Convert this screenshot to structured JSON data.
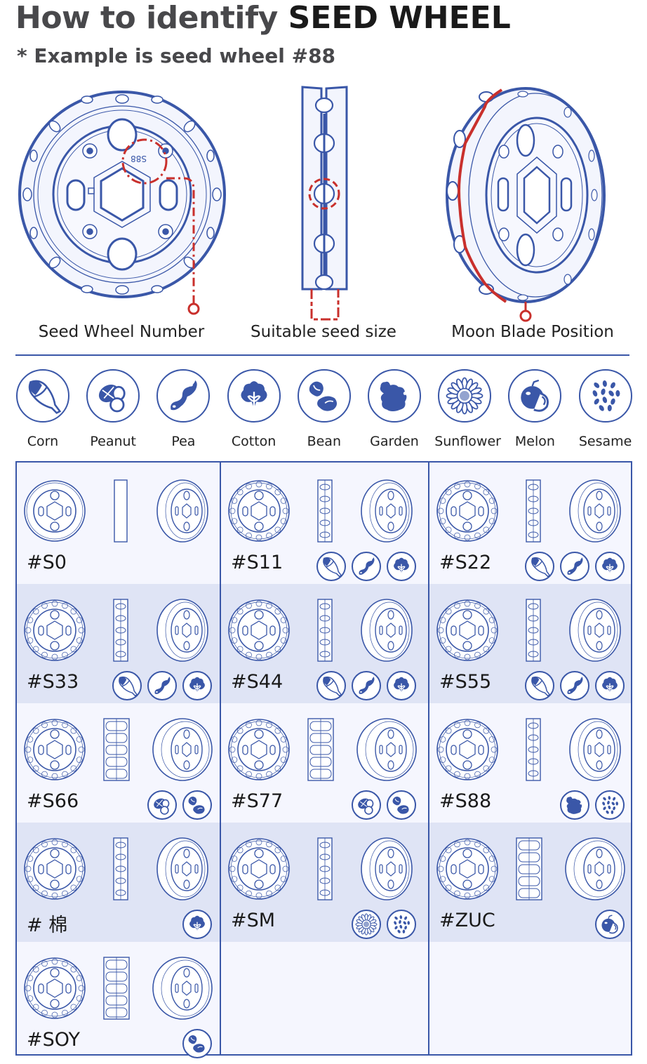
{
  "header": {
    "title_prefix": "How to identify ",
    "title_emphasis": "SEED WHEEL",
    "subtitle": "* Example is seed wheel #88"
  },
  "hero": {
    "example_code": "S88",
    "labels": [
      "Seed Wheel Number",
      "Suitable seed size",
      "Moon Blade Position"
    ]
  },
  "colors": {
    "line_blue": "#3a57a8",
    "highlight_red": "#c9302c",
    "band_blue": "#dfe4f5",
    "panel_bg": "#f5f6fe"
  },
  "seed_types": [
    {
      "key": "corn",
      "label": "Corn"
    },
    {
      "key": "peanut",
      "label": "Peanut"
    },
    {
      "key": "pea",
      "label": "Pea"
    },
    {
      "key": "cotton",
      "label": "Cotton"
    },
    {
      "key": "bean",
      "label": "Bean"
    },
    {
      "key": "garden",
      "label": "Garden"
    },
    {
      "key": "sunflower",
      "label": "Sunflower"
    },
    {
      "key": "melon",
      "label": "Melon"
    },
    {
      "key": "sesame",
      "label": "Sesame"
    }
  ],
  "wheels": [
    {
      "code": "#S0",
      "seeds": []
    },
    {
      "code": "#S11",
      "seeds": [
        "corn",
        "pea",
        "cotton"
      ]
    },
    {
      "code": "#S22",
      "seeds": [
        "corn",
        "pea",
        "cotton"
      ]
    },
    {
      "code": "#S33",
      "seeds": [
        "corn",
        "pea",
        "cotton"
      ]
    },
    {
      "code": "#S44",
      "seeds": [
        "corn",
        "pea",
        "cotton"
      ]
    },
    {
      "code": "#S55",
      "seeds": [
        "corn",
        "pea",
        "cotton"
      ]
    },
    {
      "code": "#S66",
      "seeds": [
        "peanut",
        "bean"
      ]
    },
    {
      "code": "#S77",
      "seeds": [
        "peanut",
        "bean"
      ]
    },
    {
      "code": "#S88",
      "seeds": [
        "garden",
        "sesame"
      ]
    },
    {
      "code": "# 棉",
      "seeds": [
        "cotton"
      ]
    },
    {
      "code": "#SM",
      "seeds": [
        "sunflower",
        "sesame"
      ]
    },
    {
      "code": "#ZUC",
      "seeds": [
        "melon"
      ]
    },
    {
      "code": "#SOY",
      "seeds": [
        "bean"
      ]
    }
  ]
}
